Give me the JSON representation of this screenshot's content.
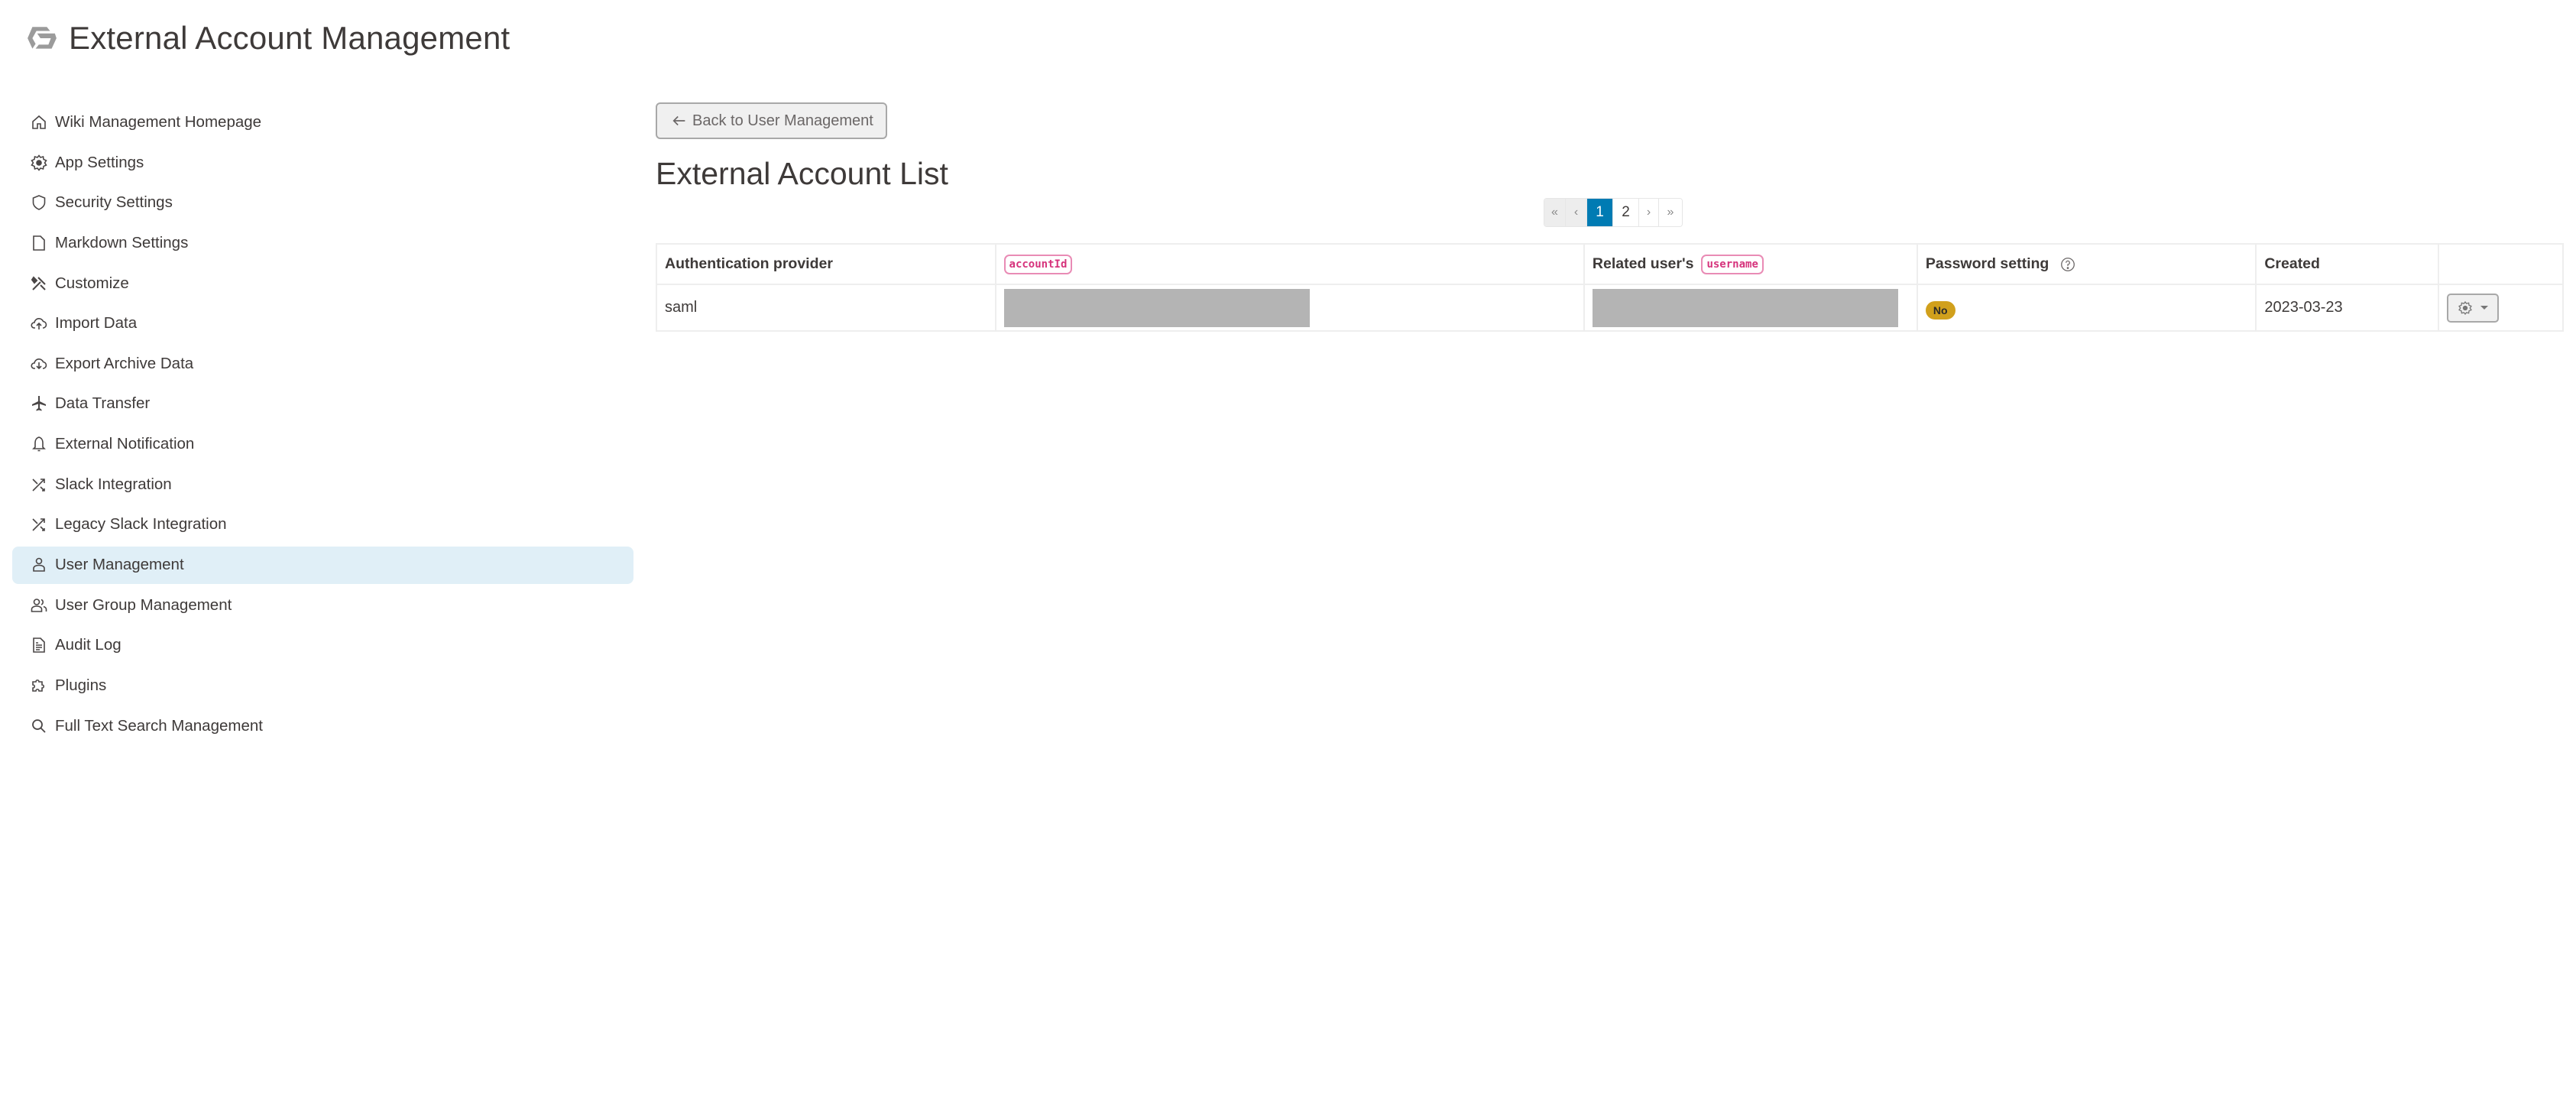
{
  "header": {
    "title": "External Account Management",
    "logo_icon": "growi-logo-icon"
  },
  "sidebar": {
    "items": [
      {
        "label": "Wiki Management Homepage",
        "icon": "home-icon",
        "active": false
      },
      {
        "label": "App Settings",
        "icon": "gear-icon",
        "active": false
      },
      {
        "label": "Security Settings",
        "icon": "shield-icon",
        "active": false
      },
      {
        "label": "Markdown Settings",
        "icon": "file-icon",
        "active": false
      },
      {
        "label": "Customize",
        "icon": "tools-icon",
        "active": false
      },
      {
        "label": "Import Data",
        "icon": "cloud-upload-icon",
        "active": false
      },
      {
        "label": "Export Archive Data",
        "icon": "cloud-download-icon",
        "active": false
      },
      {
        "label": "Data Transfer",
        "icon": "airplane-icon",
        "active": false
      },
      {
        "label": "External Notification",
        "icon": "bell-icon",
        "active": false
      },
      {
        "label": "Slack Integration",
        "icon": "shuffle-icon",
        "active": false
      },
      {
        "label": "Legacy Slack Integration",
        "icon": "shuffle-icon",
        "active": false
      },
      {
        "label": "User Management",
        "icon": "user-icon",
        "active": true
      },
      {
        "label": "User Group Management",
        "icon": "users-icon",
        "active": false
      },
      {
        "label": "Audit Log",
        "icon": "document-icon",
        "active": false
      },
      {
        "label": "Plugins",
        "icon": "puzzle-icon",
        "active": false
      },
      {
        "label": "Full Text Search Management",
        "icon": "search-icon",
        "active": false
      }
    ]
  },
  "main": {
    "back_button": {
      "label": "Back to User Management",
      "icon": "arrow-left-icon"
    },
    "list_title": "External Account List",
    "pagination": {
      "first": "«",
      "prev": "‹",
      "pages": [
        "1",
        "2"
      ],
      "current_page": "1",
      "next": "›",
      "last": "»"
    },
    "table": {
      "headers": {
        "provider": "Authentication provider",
        "account_id_code": "accountId",
        "related_user_prefix": "Related user's",
        "related_user_code": "username",
        "password_setting": "Password setting",
        "created": "Created"
      },
      "rows": [
        {
          "provider": "saml",
          "account_id": "[redacted]",
          "username": "[redacted]",
          "password_setting": "No",
          "created": "2023-03-23"
        }
      ]
    },
    "colors": {
      "accent": "#007bb3",
      "active_nav_bg": "#e0eff7",
      "code_pink": "#d6337c",
      "badge_warning": "#d1a01c",
      "redaction_gray": "#b4b4b4"
    }
  }
}
